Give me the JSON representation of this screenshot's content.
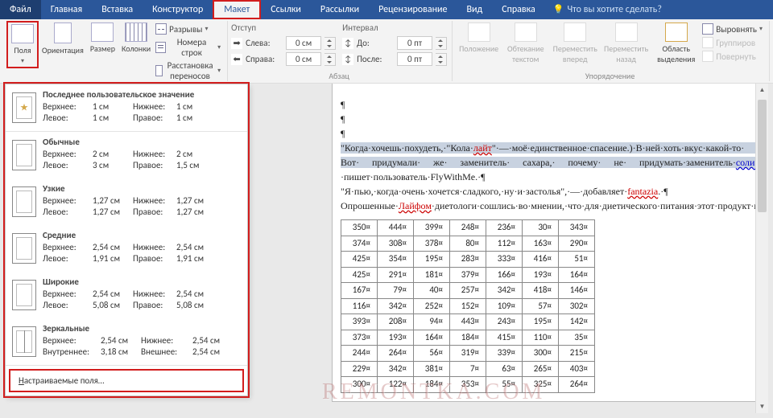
{
  "tabs": {
    "file": "Файл",
    "home": "Главная",
    "insert": "Вставка",
    "design": "Конструктор",
    "layout": "Макет",
    "refs": "Ссылки",
    "mail": "Рассылки",
    "review": "Рецензирование",
    "view": "Вид",
    "help": "Справка",
    "tellme": "Что вы хотите сделать?"
  },
  "ribbon": {
    "margins": "Поля",
    "orientation": "Ориентация",
    "size": "Размер",
    "columns": "Колонки",
    "breaks": "Разрывы",
    "line_numbers": "Номера строк",
    "hyphenation": "Расстановка переносов",
    "indent_hdr": "Отступ",
    "spacing_hdr": "Интервал",
    "left": "Слева:",
    "right": "Справа:",
    "before": "До:",
    "after": "После:",
    "left_v": "0 см",
    "right_v": "0 см",
    "before_v": "0 пт",
    "after_v": "0 пт",
    "group_para": "Абзац",
    "position": "Положение",
    "wrap": "Обтекание текстом",
    "forward": "Переместить вперед",
    "back": "Переместить назад",
    "selpane": "Область выделения",
    "align": "Выровнять",
    "group": "Группиров",
    "rotate": "Повернуть",
    "group_arrange": "Упорядочение"
  },
  "dropdown": {
    "last": {
      "title": "Последнее пользовательское значение",
      "top_l": "Верхнее:",
      "top_v": "1 см",
      "bot_l": "Нижнее:",
      "bot_v": "1 см",
      "left_l": "Левое:",
      "left_v": "1 см",
      "right_l": "Правое:",
      "right_v": "1 см"
    },
    "normal": {
      "title": "Обычные",
      "top_l": "Верхнее:",
      "top_v": "2 см",
      "bot_l": "Нижнее:",
      "bot_v": "2 см",
      "left_l": "Левое:",
      "left_v": "3 см",
      "right_l": "Правое:",
      "right_v": "1,5 см"
    },
    "narrow": {
      "title": "Узкие",
      "top_l": "Верхнее:",
      "top_v": "1,27 см",
      "bot_l": "Нижнее:",
      "bot_v": "1,27 см",
      "left_l": "Левое:",
      "left_v": "1,27 см",
      "right_l": "Правое:",
      "right_v": "1,27 см"
    },
    "moderate": {
      "title": "Средние",
      "top_l": "Верхнее:",
      "top_v": "2,54 см",
      "bot_l": "Нижнее:",
      "bot_v": "2,54 см",
      "left_l": "Левое:",
      "left_v": "1,91 см",
      "right_l": "Правое:",
      "right_v": "1,91 см"
    },
    "wide": {
      "title": "Широкие",
      "top_l": "Верхнее:",
      "top_v": "2,54 см",
      "bot_l": "Нижнее:",
      "bot_v": "2,54 см",
      "left_l": "Левое:",
      "left_v": "5,08 см",
      "right_l": "Правое:",
      "right_v": "5,08 см"
    },
    "mirrored": {
      "title": "Зеркальные",
      "top_l": "Верхнее:",
      "top_v": "2,54 см",
      "bot_l": "Нижнее:",
      "bot_v": "2,54 см",
      "left_l": "Внутреннее:",
      "left_v": "3,18 см",
      "right_l": "Внешнее:",
      "right_v": "2,54 см"
    },
    "custom": "Настраиваемые поля…"
  },
  "doc": {
    "para1_a": "\"Когда·хочешь·похудеть,·\"Кола·",
    "para1_lite": "лайт",
    "para1_b": "\"·—·моё·единственное·спасение.)·В·ней·хоть·вкус·какой-то· есть.)· Вот· придумали· же· заменитель· сахара,· почему· не· придумать·заменитель·",
    "para1_salt": "соли?:)",
    "para1_c": "\"·—·пишет·пользователь·FlyWithMe.·¶",
    "para2_a": "\"Я·пью,·когда·очень·хочется·сладкого,·ну·и·застолья\",·—·добавляет·",
    "para2_user": "fantazia",
    "para2_b": ".·¶",
    "para3_a": "Опрошенные·",
    "para3_lh": "Лайфом",
    "para3_b": "·диетологи·сошлись·во·мнении,·что·для·диетического·питания·этот·продукт·не·подходит·и·вообще·диетическая·газировка·вредна·для·здоровья.·¶"
  },
  "table": [
    [
      "350¤",
      "444¤",
      "399¤",
      "248¤",
      "236¤",
      "30¤",
      "343¤"
    ],
    [
      "374¤",
      "308¤",
      "378¤",
      "80¤",
      "112¤",
      "163¤",
      "290¤"
    ],
    [
      "425¤",
      "354¤",
      "195¤",
      "283¤",
      "333¤",
      "416¤",
      "51¤"
    ],
    [
      "425¤",
      "291¤",
      "181¤",
      "379¤",
      "166¤",
      "193¤",
      "164¤"
    ],
    [
      "167¤",
      "79¤",
      "40¤",
      "257¤",
      "342¤",
      "418¤",
      "146¤"
    ],
    [
      "116¤",
      "342¤",
      "252¤",
      "152¤",
      "109¤",
      "57¤",
      "302¤"
    ],
    [
      "393¤",
      "208¤",
      "94¤",
      "443¤",
      "243¤",
      "195¤",
      "142¤"
    ],
    [
      "373¤",
      "193¤",
      "164¤",
      "184¤",
      "415¤",
      "110¤",
      "35¤"
    ],
    [
      "244¤",
      "264¤",
      "56¤",
      "319¤",
      "339¤",
      "300¤",
      "215¤"
    ],
    [
      "229¤",
      "342¤",
      "381¤",
      "7¤",
      "63¤",
      "265¤",
      "403¤"
    ],
    [
      "300¤",
      "122¤",
      "184¤",
      "353¤",
      "55¤",
      "325¤",
      "264¤"
    ]
  ],
  "watermark": "REMONTKA.COM"
}
